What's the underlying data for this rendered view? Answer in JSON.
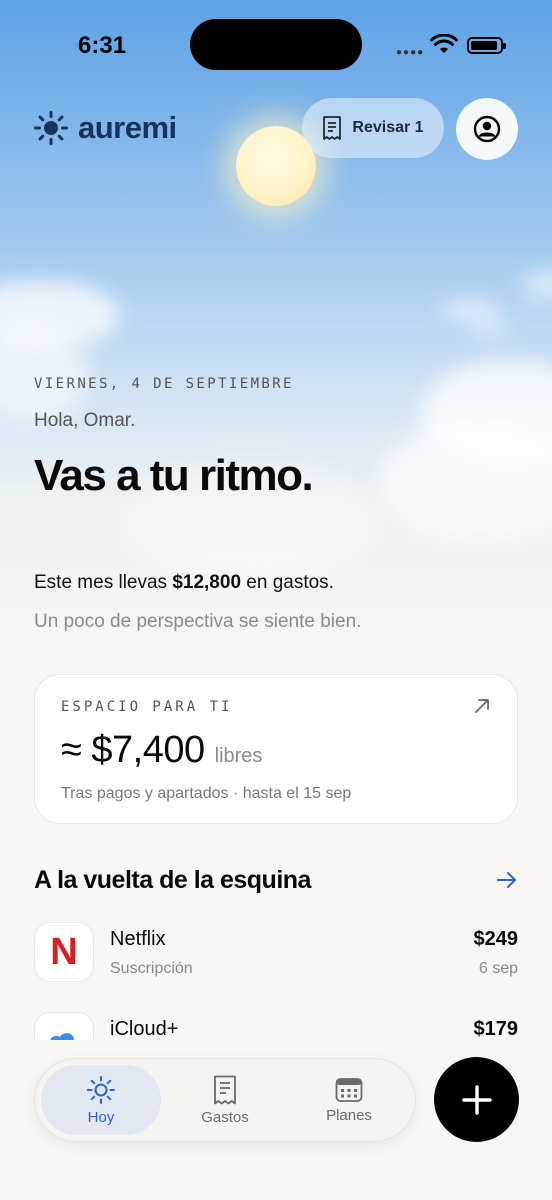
{
  "status_bar": {
    "time": "6:31"
  },
  "header": {
    "brand_name": "auremi",
    "review_button": "Revisar 1"
  },
  "hero": {
    "date": "VIERNES, 4 DE SEPTIEMBRE",
    "greeting": "Hola, Omar.",
    "headline": "Vas a tu ritmo.",
    "summary_prefix": "Este mes llevas ",
    "summary_amount": "$12,800",
    "summary_suffix": " en gastos.",
    "perspective": "Un poco de perspectiva se siente bien."
  },
  "space_card": {
    "label": "ESPACIO PARA TI",
    "amount": "≈ $7,400",
    "amount_suffix": "libres",
    "note": "Tras pagos y apartados · hasta el 15 sep"
  },
  "upcoming": {
    "title": "A la vuelta de la esquina",
    "items": [
      {
        "name": "Netflix",
        "subtitle": "Suscripción",
        "amount": "$249",
        "date": "6 sep",
        "logo_text": "N"
      },
      {
        "name": "iCloud+",
        "subtitle": "",
        "amount": "$179",
        "date": ""
      }
    ]
  },
  "tabbar": {
    "tabs": [
      {
        "label": "Hoy",
        "icon": "sun-icon",
        "active": true
      },
      {
        "label": "Gastos",
        "icon": "receipt-icon",
        "active": false
      },
      {
        "label": "Planes",
        "icon": "calendar-icon",
        "active": false
      }
    ]
  },
  "colors": {
    "accent": "#2b63c6",
    "brand": "#16325c",
    "netflix_red": "#d81f26",
    "icloud_blue": "#3a8ee6"
  }
}
